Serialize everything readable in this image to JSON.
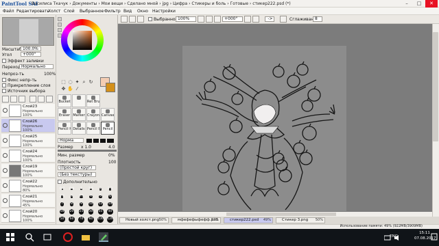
{
  "app": {
    "logo": "PaintTool SAI",
    "title": "Василиса Ткачук › Документы › Мои вещи › Сделано мной › jpg › Цифра › Стикеры и боль › Готовые › стикер222.psd (*)"
  },
  "menu": [
    "Файл",
    "Редактировать",
    "Холст",
    "Слой",
    "Выбранное",
    "Фильтр",
    "Вид",
    "Окно",
    "Настройки"
  ],
  "toolbar": {
    "selection_label": "Выбранное",
    "zoom": "100%",
    "angle": "+000°",
    "arrow_label": "->",
    "smoothing_label": "Сглаживание",
    "smoothing_value": "8"
  },
  "navigator": {
    "zoom_label": "Масштаб",
    "zoom_value": "100.0%",
    "angle_label": "Угол",
    "angle_value": "+000°"
  },
  "layer_panel": {
    "effect_label": "Эффект заливки",
    "mode_label": "Переход",
    "mode_value": "Нормально",
    "opacity_label": "Непроз-ть",
    "opacity_value": "100%",
    "checks": [
      "Фикс непр-ть",
      "Прикрепление слоя",
      "Источник выбора"
    ],
    "layers": [
      {
        "name": "Слой23",
        "mode": "Нормально",
        "opacity": "100%",
        "selected": false
      },
      {
        "name": "Слой26",
        "mode": "Нормально",
        "opacity": "100%",
        "selected": true
      },
      {
        "name": "Слой25",
        "mode": "Нормально",
        "opacity": "100%",
        "selected": false
      },
      {
        "name": "Слой24",
        "mode": "Нормально",
        "opacity": "100%",
        "selected": false
      },
      {
        "name": "Слой19",
        "mode": "Нормально",
        "opacity": "100%",
        "selected": false
      },
      {
        "name": "Слой22",
        "mode": "Нормально",
        "opacity": "80%",
        "selected": false
      },
      {
        "name": "Слой21",
        "mode": "Нормально",
        "opacity": "45%",
        "selected": false
      },
      {
        "name": "Слой20",
        "mode": "Нормально",
        "opacity": "100%",
        "selected": false
      }
    ]
  },
  "brushes": [
    [
      "Bucket",
      "",
      "Ret Brush"
    ],
    [
      "Eraser",
      "Marker",
      "Crayon",
      "Canvas Acryl"
    ],
    [
      "Pencil HB",
      "Details",
      "Pencil B",
      "Pencil"
    ]
  ],
  "brush_props": {
    "mode": "Норма",
    "size_label": "Размер",
    "size_mult": "x 1.0",
    "size_value": "4.0",
    "min_size_label": "Мин. размер",
    "min_size_value": "0%",
    "density_label": "Плотность",
    "density_value": "100",
    "shape1": "(Простой круг)",
    "shape2": "(Без текстуры)",
    "more_label": "Дополнительно",
    "sizes": [
      "0.7",
      "0.8",
      "1",
      "1.5",
      "2",
      "2.3",
      "2.6",
      "3",
      "3.5",
      "4",
      "5",
      "6",
      "7",
      "8",
      "9",
      "10",
      "12",
      "14",
      "16",
      "20",
      "25",
      "30",
      "35",
      "40",
      "50",
      "60",
      "70",
      "80",
      "100",
      "120"
    ]
  },
  "tabs": [
    {
      "name": "Новый холст.png",
      "pct": "50%",
      "active": false
    },
    {
      "name": "мфефефыфефф.psd",
      "pct": "12%",
      "active": false
    },
    {
      "name": "стикер222.psd",
      "pct": "49%",
      "active": true
    },
    {
      "name": "Стикер 3.png",
      "pct": "50%",
      "active": false
    }
  ],
  "status": {
    "memory": "Использование памяти: 49% (922MB/3909MB)"
  },
  "taskbar": {
    "lang": "ENG",
    "time": "15:11",
    "date": "07.08.2017"
  },
  "colors": {
    "accent": "#c8c9ef",
    "canvas_bg": "#7c7c7c",
    "paper": "#8c8c8c",
    "primary": "#f4cdb3"
  }
}
